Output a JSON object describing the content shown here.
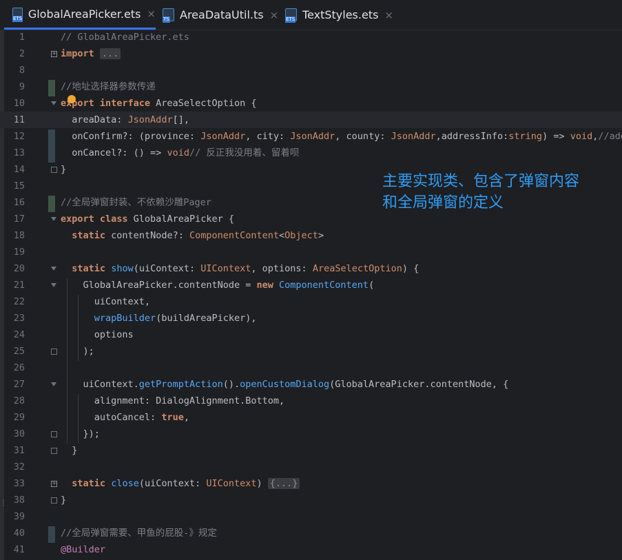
{
  "tabs": [
    {
      "label": "GlobalAreaPicker.ets",
      "badge": "ETS",
      "active": true
    },
    {
      "label": "AreaDataUtil.ts",
      "badge": "TS",
      "active": false
    },
    {
      "label": "TextStyles.ets",
      "badge": "ETS",
      "active": false
    }
  ],
  "close_glyph": "×",
  "annotation": [
    "主要实现类、包含了弹窗内容",
    "和全局弹窗的定义"
  ],
  "lines": [
    {
      "n": "1",
      "html": "<span class='c'>// GlobalAreaPicker.ets</span>"
    },
    {
      "n": "2",
      "html": "<span class='k'>import</span> <span class='fold'>...</span>"
    },
    {
      "n": "8",
      "html": ""
    },
    {
      "n": "9",
      "html": "<span class='c'>//地址选择器参数传递</span>"
    },
    {
      "n": "10",
      "html": "<span class='k'>export interface</span> AreaSelectOption {"
    },
    {
      "n": "11",
      "html": "  areaData: <span class='t'>JsonAddr</span>[],"
    },
    {
      "n": "12",
      "html": "  onConfirm?: (province: <span class='t'>JsonAddr</span>, city: <span class='t'>JsonAddr</span>, county: <span class='t'>JsonAddr</span>,addressInfo:<span class='t'>string</span>) => <span class='t'>void</span>,<span class='c'>//addr</span>"
    },
    {
      "n": "13",
      "html": "  onCancel?: () => <span class='t'>void</span><span class='c'>// 反正我没用着、留着呗</span>"
    },
    {
      "n": "14",
      "html": "}"
    },
    {
      "n": "15",
      "html": ""
    },
    {
      "n": "16",
      "html": "<span class='c'>//全局弹窗封装、不依赖沙雕Pager</span>"
    },
    {
      "n": "17",
      "html": "<span class='k'>export class</span> GlobalAreaPicker {"
    },
    {
      "n": "18",
      "html": "  <span class='k'>static</span> contentNode?: <span class='t'>ComponentContent</span>&lt;<span class='t'>Object</span>&gt;"
    },
    {
      "n": "19",
      "html": ""
    },
    {
      "n": "20",
      "html": "  <span class='k'>static</span> <span class='f'>show</span>(uiContext: <span class='t'>UIContext</span>, options: <span class='t'>AreaSelectOption</span>) {"
    },
    {
      "n": "21",
      "html": "    GlobalAreaPicker.contentNode = <span class='k'>new</span> <span class='f'>ComponentContent</span>("
    },
    {
      "n": "22",
      "html": "      uiContext,"
    },
    {
      "n": "23",
      "html": "      <span class='f'>wrapBuilder</span>(buildAreaPicker),"
    },
    {
      "n": "24",
      "html": "      options"
    },
    {
      "n": "25",
      "html": "    );"
    },
    {
      "n": "26",
      "html": ""
    },
    {
      "n": "27",
      "html": "    uiContext.<span class='f'>getPromptAction</span>().<span class='f'>openCustomDialog</span>(GlobalAreaPicker.contentNode, {"
    },
    {
      "n": "28",
      "html": "      alignment: DialogAlignment.Bottom,"
    },
    {
      "n": "29",
      "html": "      autoCancel: <span class='k'>true</span>,"
    },
    {
      "n": "30",
      "html": "    });"
    },
    {
      "n": "31",
      "html": "  }"
    },
    {
      "n": "32",
      "html": ""
    },
    {
      "n": "33",
      "html": "  <span class='k'>static</span> <span class='f'>close</span>(uiContext: <span class='t'>UIContext</span>) <span class='fold'>{...}</span>"
    },
    {
      "n": "38",
      "html": "}"
    },
    {
      "n": "39",
      "html": ""
    },
    {
      "n": "40",
      "html": "<span class='c'>//全局弹窗需要、甲鱼的屁股-》规定</span>"
    },
    {
      "n": "41",
      "html": "<span class='tw'>@Builder</span>"
    }
  ]
}
